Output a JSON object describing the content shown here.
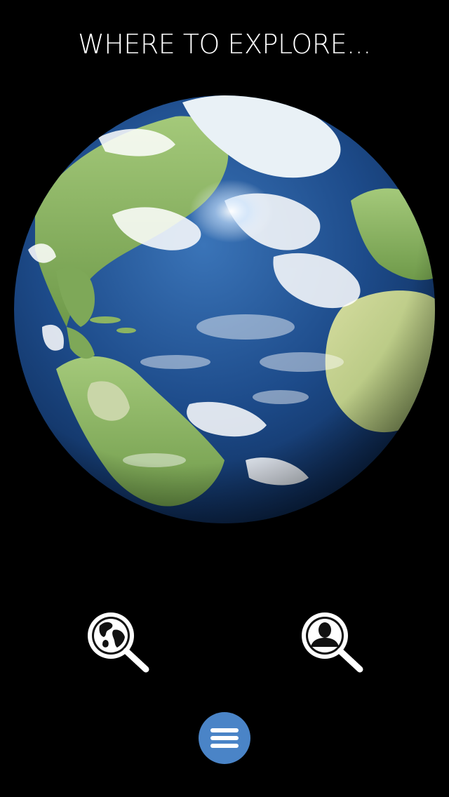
{
  "header": {
    "title": "WHERE TO EXPLORE..."
  },
  "globe": {
    "icon": "earth-globe-image",
    "colors": {
      "ocean": "#1f4f8f",
      "land": "#8fb865",
      "cloud": "#ffffff",
      "background": "#000000"
    }
  },
  "actions": {
    "explore_places_icon": "globe-search-icon",
    "explore_people_icon": "person-search-icon"
  },
  "menu": {
    "icon": "hamburger-menu-icon",
    "color": "#4a84c7"
  }
}
